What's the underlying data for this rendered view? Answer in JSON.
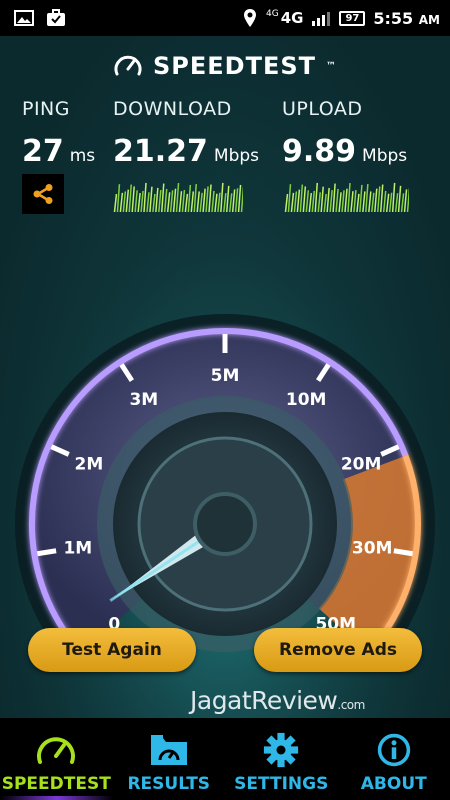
{
  "status_bar": {
    "network_small": "4G",
    "network": "4G",
    "battery": "97",
    "time": "5:55",
    "ampm": "AM",
    "icons": [
      "image-icon",
      "briefcase-check-icon",
      "location-icon",
      "signal-icon"
    ]
  },
  "app": {
    "logo_text": "SPEEDTEST",
    "logo_tm": "™"
  },
  "metrics": {
    "ping": {
      "label": "PING",
      "value": "27",
      "unit": "ms"
    },
    "download": {
      "label": "DOWNLOAD",
      "value": "21.27",
      "unit": "Mbps"
    },
    "upload": {
      "label": "UPLOAD",
      "value": "9.89",
      "unit": "Mbps"
    }
  },
  "gauge": {
    "ticks": [
      "0",
      "1M",
      "2M",
      "3M",
      "5M",
      "10M",
      "20M",
      "30M",
      "50M"
    ],
    "needle_value": "0",
    "colors": {
      "ring": "#8a63d2",
      "ring_glow": "#d7c6ff",
      "orange": "#ff8f3a",
      "face": "#2e4a52"
    }
  },
  "buttons": {
    "test_again": "Test Again",
    "remove_ads": "Remove Ads"
  },
  "watermark": {
    "brand": "JagatReview",
    "suffix": ".com"
  },
  "nav": {
    "items": [
      {
        "label": "SPEEDTEST",
        "icon": "speedometer-icon",
        "active": true
      },
      {
        "label": "RESULTS",
        "icon": "folder-gauge-icon",
        "active": false
      },
      {
        "label": "SETTINGS",
        "icon": "gear-icon",
        "active": false
      },
      {
        "label": "ABOUT",
        "icon": "info-icon",
        "active": false
      }
    ]
  },
  "colors": {
    "accent_blue": "#2fb7e8",
    "accent_green": "#a7e01d",
    "button_gold": "#e8ac25"
  }
}
